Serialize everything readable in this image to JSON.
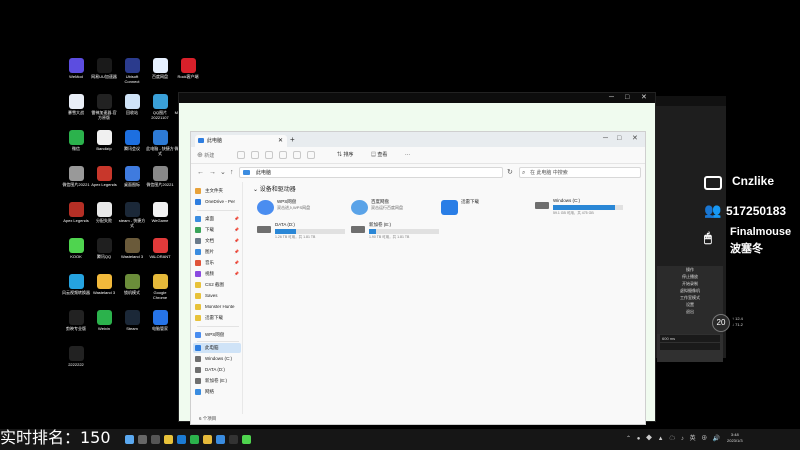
{
  "desktop": {
    "icons": [
      {
        "label": "WeMod",
        "color": "#5c4de0"
      },
      {
        "label": "网易UU加速器",
        "color": "#1a1a1a"
      },
      {
        "label": "Ubisoft Connect",
        "color": "#2b3b8d"
      },
      {
        "label": "百度网盘",
        "color": "#e6f0ff"
      },
      {
        "label": "Rock客户端",
        "color": "#d8202a"
      },
      {
        "label": "暴雪大战",
        "color": "#e9eef7"
      },
      {
        "label": "雷神加速器-官方原版",
        "color": "#222222"
      },
      {
        "label": "回收站",
        "color": "#cfe3f7"
      },
      {
        "label": "QQ图片20221107",
        "color": "#3aa0d8"
      },
      {
        "label": "Microsoft Edge",
        "color": "#1c7bd4"
      },
      {
        "label": "微信",
        "color": "#2bb24c"
      },
      {
        "label": "Bandizip",
        "color": "#f0f0f0"
      },
      {
        "label": "腾讯会议",
        "color": "#1d6fe0"
      },
      {
        "label": "此电脑 - 快捷方式",
        "color": "#2d7bd6"
      },
      {
        "label": "微信图片20221",
        "color": "#cccccc"
      },
      {
        "label": "微信图片20221",
        "color": "#999999"
      },
      {
        "label": "Apex Legends",
        "color": "#c8372b"
      },
      {
        "label": "桌面图标",
        "color": "#3f7bdf"
      },
      {
        "label": "微信图片20221",
        "color": "#888888"
      },
      {
        "label": "抖音",
        "color": "#111111"
      },
      {
        "label": "Apex Legends",
        "color": "#b52f25"
      },
      {
        "label": "分配失败",
        "color": "#e8e8e8"
      },
      {
        "label": "steam - 快捷方式",
        "color": "#1b2838"
      },
      {
        "label": "WeGame",
        "color": "#f2f2f2"
      },
      {
        "label": "12.12",
        "color": "#2a6acb"
      },
      {
        "label": "KOOK",
        "color": "#4fd44f"
      },
      {
        "label": "腾讯QQ",
        "color": "#1f1f1f"
      },
      {
        "label": "Wasteland 3",
        "color": "#6a5a3a"
      },
      {
        "label": "VALORANT",
        "color": "#e03a3a"
      },
      {
        "label": "迅雷",
        "color": "#2a7ee6"
      },
      {
        "label": "风云视频转换器",
        "color": "#25a3e0"
      },
      {
        "label": "Wasteland 3",
        "color": "#f2b93b"
      },
      {
        "label": "锁机模式",
        "color": "#6b8d3a"
      },
      {
        "label": "Google Chrome",
        "color": "#e5b93a"
      },
      {
        "label": "网易云音乐",
        "color": "#d52b2b"
      },
      {
        "label": "剪映专业版",
        "color": "#222222"
      },
      {
        "label": "Weixin",
        "color": "#2bb24c"
      },
      {
        "label": "Steam",
        "color": "#1b2838"
      },
      {
        "label": "电脑管家",
        "color": "#2674e8"
      },
      {
        "label": "Adobe Premiere",
        "color": "#2a1458"
      },
      {
        "label": "2222222",
        "color": "#222222"
      }
    ]
  },
  "bg_window": {
    "controls": {
      "min": "─",
      "max": "□",
      "close": "✕"
    }
  },
  "explorer": {
    "tab_title": "此电脑",
    "tab_close": "✕",
    "tab_add": "+",
    "win_min": "─",
    "win_max": "□",
    "win_close": "✕",
    "cmd": {
      "new": "新建",
      "sort": "排序",
      "view": "查看",
      "more": "···"
    },
    "nav": {
      "back": "←",
      "forward": "→",
      "down": "⌄",
      "up": "↑"
    },
    "address": "此电脑",
    "refresh": "↻",
    "search_placeholder": "在 此电脑 中搜索",
    "search_icon": "⌕",
    "section_title": "设备和驱动器",
    "cards": [
      {
        "name": "WPS网盘",
        "sub": "双击进入WPS网盘",
        "icon_color": "#4a8df0"
      },
      {
        "name": "百度网盘",
        "sub": "双击运行百度网盘",
        "icon_color": "#5aa3e8"
      },
      {
        "name": "迅雷下载",
        "sub": "",
        "icon_color": "#2a7ee6"
      }
    ],
    "drives": [
      {
        "name": "Windows (C:)",
        "stats": "59.1 GB 可用，共 475 GB",
        "used": 0.88
      },
      {
        "name": "DATA (D:)",
        "stats": "1.26 TB 可用，共 1.81 TB",
        "used": 0.3
      },
      {
        "name": "新加卷 (E:)",
        "stats": "1.90 TB 可用，共 1.81 TB",
        "used": 0.1
      }
    ],
    "sidebar": [
      {
        "label": "主文件夹",
        "color": "#e8a23a",
        "pin": ""
      },
      {
        "label": "OneDrive - Per",
        "color": "#2f7ee0",
        "pin": ""
      },
      {
        "label": "桌面",
        "color": "#3a8ce0",
        "pin": "📌"
      },
      {
        "label": "下载",
        "color": "#3aa35a",
        "pin": "📌"
      },
      {
        "label": "文档",
        "color": "#6a7a8a",
        "pin": "📌"
      },
      {
        "label": "图片",
        "color": "#3a8ce0",
        "pin": "📌"
      },
      {
        "label": "音乐",
        "color": "#e0543a",
        "pin": "📌"
      },
      {
        "label": "视频",
        "color": "#8a4ae0",
        "pin": "📌"
      },
      {
        "label": "CS2 截图",
        "color": "#e8c23a",
        "pin": ""
      },
      {
        "label": "Saves",
        "color": "#e8c23a",
        "pin": ""
      },
      {
        "label": "Monster Hunte",
        "color": "#e8c23a",
        "pin": ""
      },
      {
        "label": "迅雷下载",
        "color": "#e8c23a",
        "pin": ""
      },
      {
        "label": "WPS网盘",
        "color": "#4a8df0",
        "pin": ""
      },
      {
        "label": "此电脑",
        "color": "#2f7ee0",
        "pin": ""
      },
      {
        "label": "Windows (C:)",
        "color": "#6f6f6f",
        "pin": ""
      },
      {
        "label": "DATA (D:)",
        "color": "#6f6f6f",
        "pin": ""
      },
      {
        "label": "新加卷 (E:)",
        "color": "#6f6f6f",
        "pin": ""
      },
      {
        "label": "网络",
        "color": "#3a8ce0",
        "pin": ""
      }
    ],
    "status": "6 个项目"
  },
  "right_window": {
    "menu": [
      "操作",
      "停止播放",
      "开始录制",
      "虚拟摄像机",
      "工作室模式",
      "设置",
      "退出"
    ],
    "panel": [
      "600 ms",
      ""
    ]
  },
  "overlay": {
    "name": "Cnzlike",
    "qq": "517250183",
    "mouse_brand": "Finalmouse",
    "mouse_model": "波塞冬",
    "fps": "20",
    "fps_info_1": "↑ 12.4",
    "fps_info_2": "↓ 71.2"
  },
  "rank_text": "实时排名：150",
  "taskbar": {
    "apps": [
      {
        "name": "start",
        "color": "#5aa8f0"
      },
      {
        "name": "search",
        "color": "#666666"
      },
      {
        "name": "taskview",
        "color": "#555555"
      },
      {
        "name": "explorer",
        "color": "#e8c23a"
      },
      {
        "name": "edge",
        "color": "#1c7bd4"
      },
      {
        "name": "wechat",
        "color": "#2bb24c"
      },
      {
        "name": "chrome",
        "color": "#e5b93a"
      },
      {
        "name": "app",
        "color": "#3a8ce0"
      },
      {
        "name": "obs",
        "color": "#333333"
      },
      {
        "name": "kook",
        "color": "#4fd44f"
      }
    ],
    "tray": "⌃ ● ◆ ▲ ☁ ♪ 英 ⊕ 🔊",
    "time": "3:48",
    "date": "2023/1/3"
  }
}
